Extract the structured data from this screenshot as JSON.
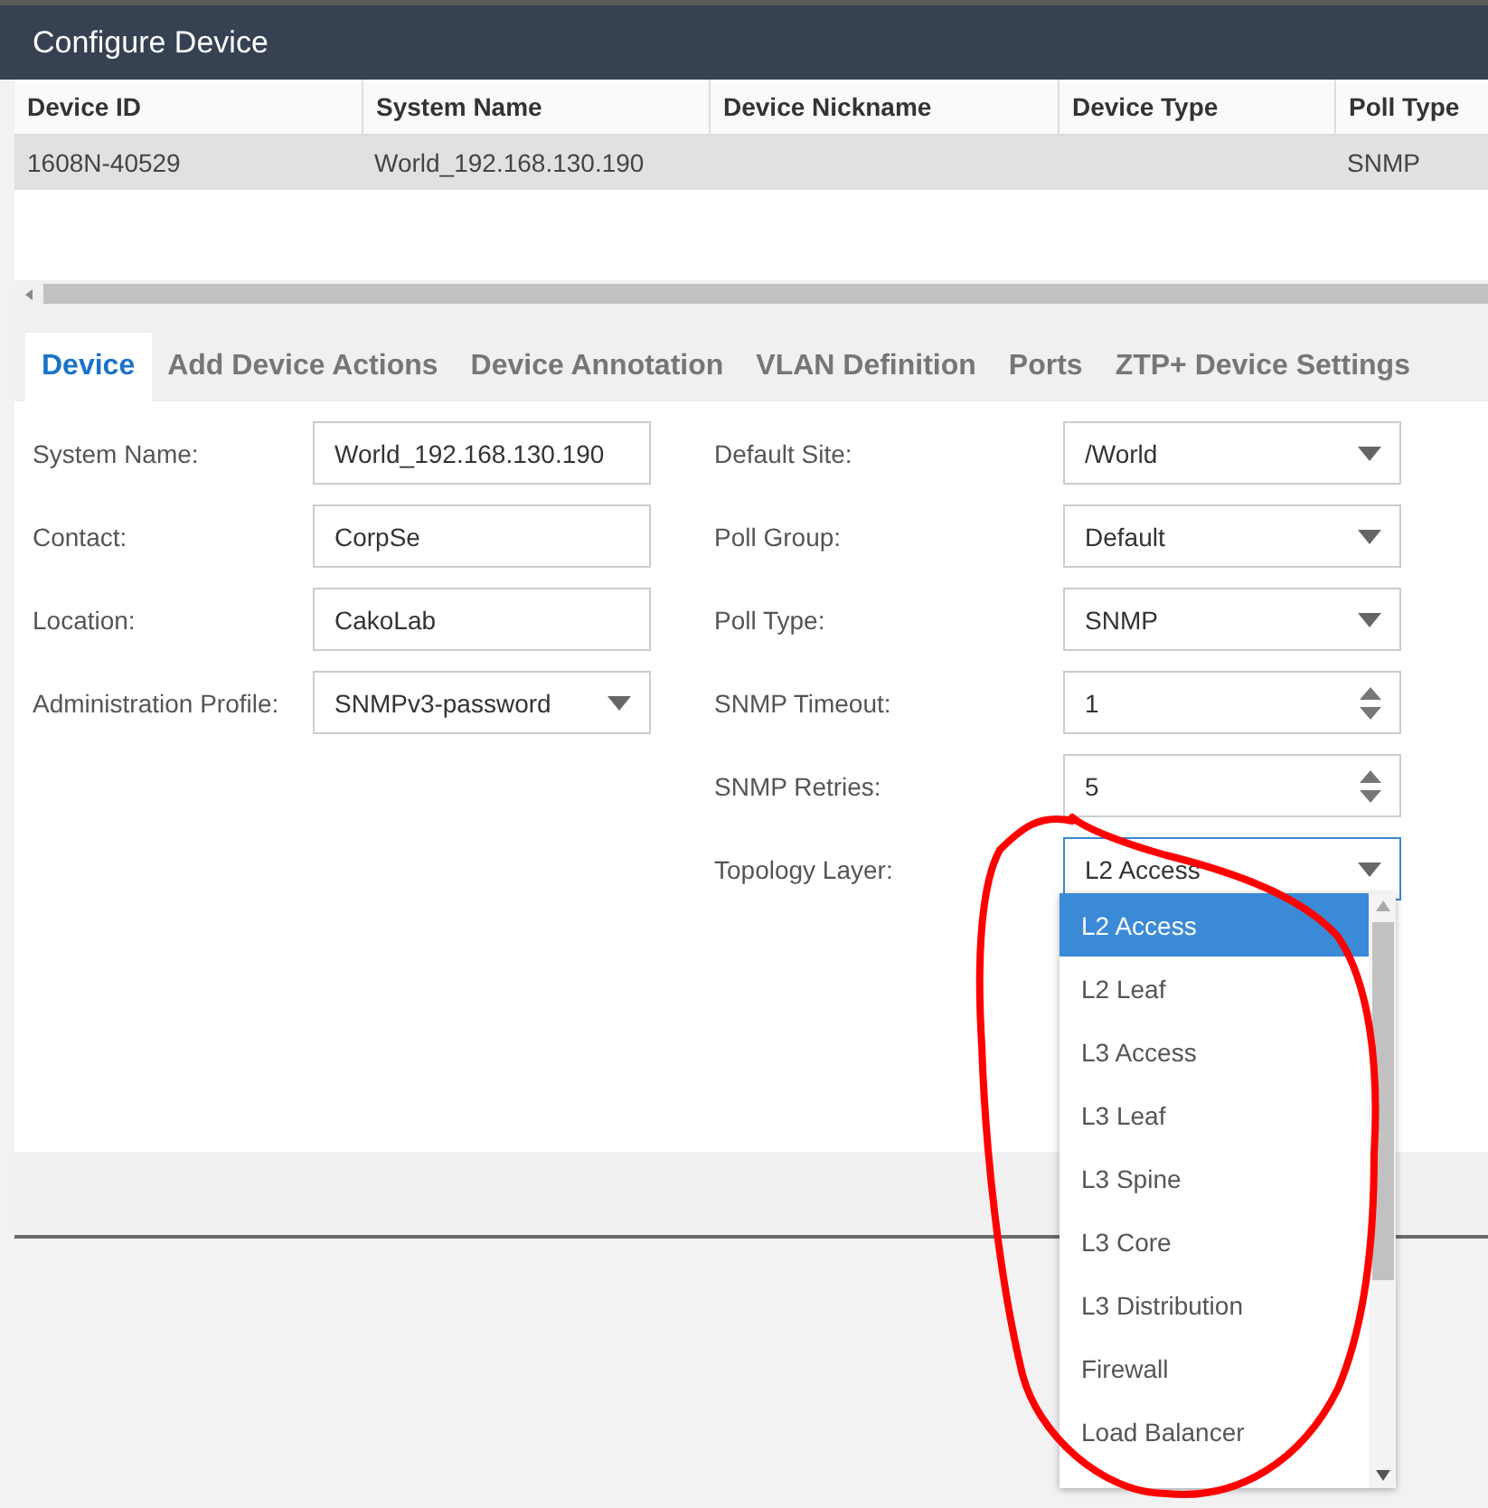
{
  "window": {
    "title": "Configure Device"
  },
  "table": {
    "columns": [
      "Device ID",
      "System Name",
      "Device Nickname",
      "Device Type",
      "Poll Type"
    ],
    "rows": [
      {
        "device_id": "1608N-40529",
        "system_name": "World_192.168.130.190",
        "poll_type": "SNMP",
        "selected": true
      }
    ]
  },
  "tabs": [
    {
      "label": "Device",
      "selected": true
    },
    {
      "label": "Add Device Actions",
      "selected": false
    },
    {
      "label": "Device Annotation",
      "selected": false
    },
    {
      "label": "VLAN Definition",
      "selected": false
    },
    {
      "label": "Ports",
      "selected": false
    },
    {
      "label": "ZTP+ Device Settings",
      "selected": false
    }
  ],
  "left_fields": [
    {
      "label": "System Name:",
      "kind": "text",
      "value": "World_192.168.130.190",
      "expanded": false
    },
    {
      "label": "Contact:",
      "kind": "text",
      "value": "CorpSe",
      "expanded": false
    },
    {
      "label": "Location:",
      "kind": "text",
      "value": "CakoLab",
      "expanded": false
    },
    {
      "label": "Administration Profile:",
      "kind": "select",
      "value": "SNMPv3-password",
      "expanded": false
    }
  ],
  "right_fields": [
    {
      "label": "Default Site:",
      "kind": "select",
      "value": "/World",
      "expanded": false
    },
    {
      "label": "Poll Group:",
      "kind": "select",
      "value": "Default",
      "expanded": false
    },
    {
      "label": "Poll Type:",
      "kind": "select",
      "value": "SNMP",
      "expanded": false
    },
    {
      "label": "SNMP Timeout:",
      "kind": "spinner",
      "value": "1",
      "expanded": false
    },
    {
      "label": "SNMP Retries:",
      "kind": "spinner",
      "value": "5",
      "expanded": false
    },
    {
      "label": "Topology Layer:",
      "kind": "select",
      "value": "L2 Access",
      "expanded": true
    }
  ],
  "dropdown_options": [
    {
      "label": "L2 Access",
      "selected": true
    },
    {
      "label": "L2 Leaf",
      "selected": false
    },
    {
      "label": "L3 Access",
      "selected": false
    },
    {
      "label": "L3 Leaf",
      "selected": false
    },
    {
      "label": "L3 Spine",
      "selected": false
    },
    {
      "label": "L3 Core",
      "selected": false
    },
    {
      "label": "L3 Distribution",
      "selected": false
    },
    {
      "label": "Firewall",
      "selected": false
    },
    {
      "label": "Load Balancer",
      "selected": false
    }
  ]
}
